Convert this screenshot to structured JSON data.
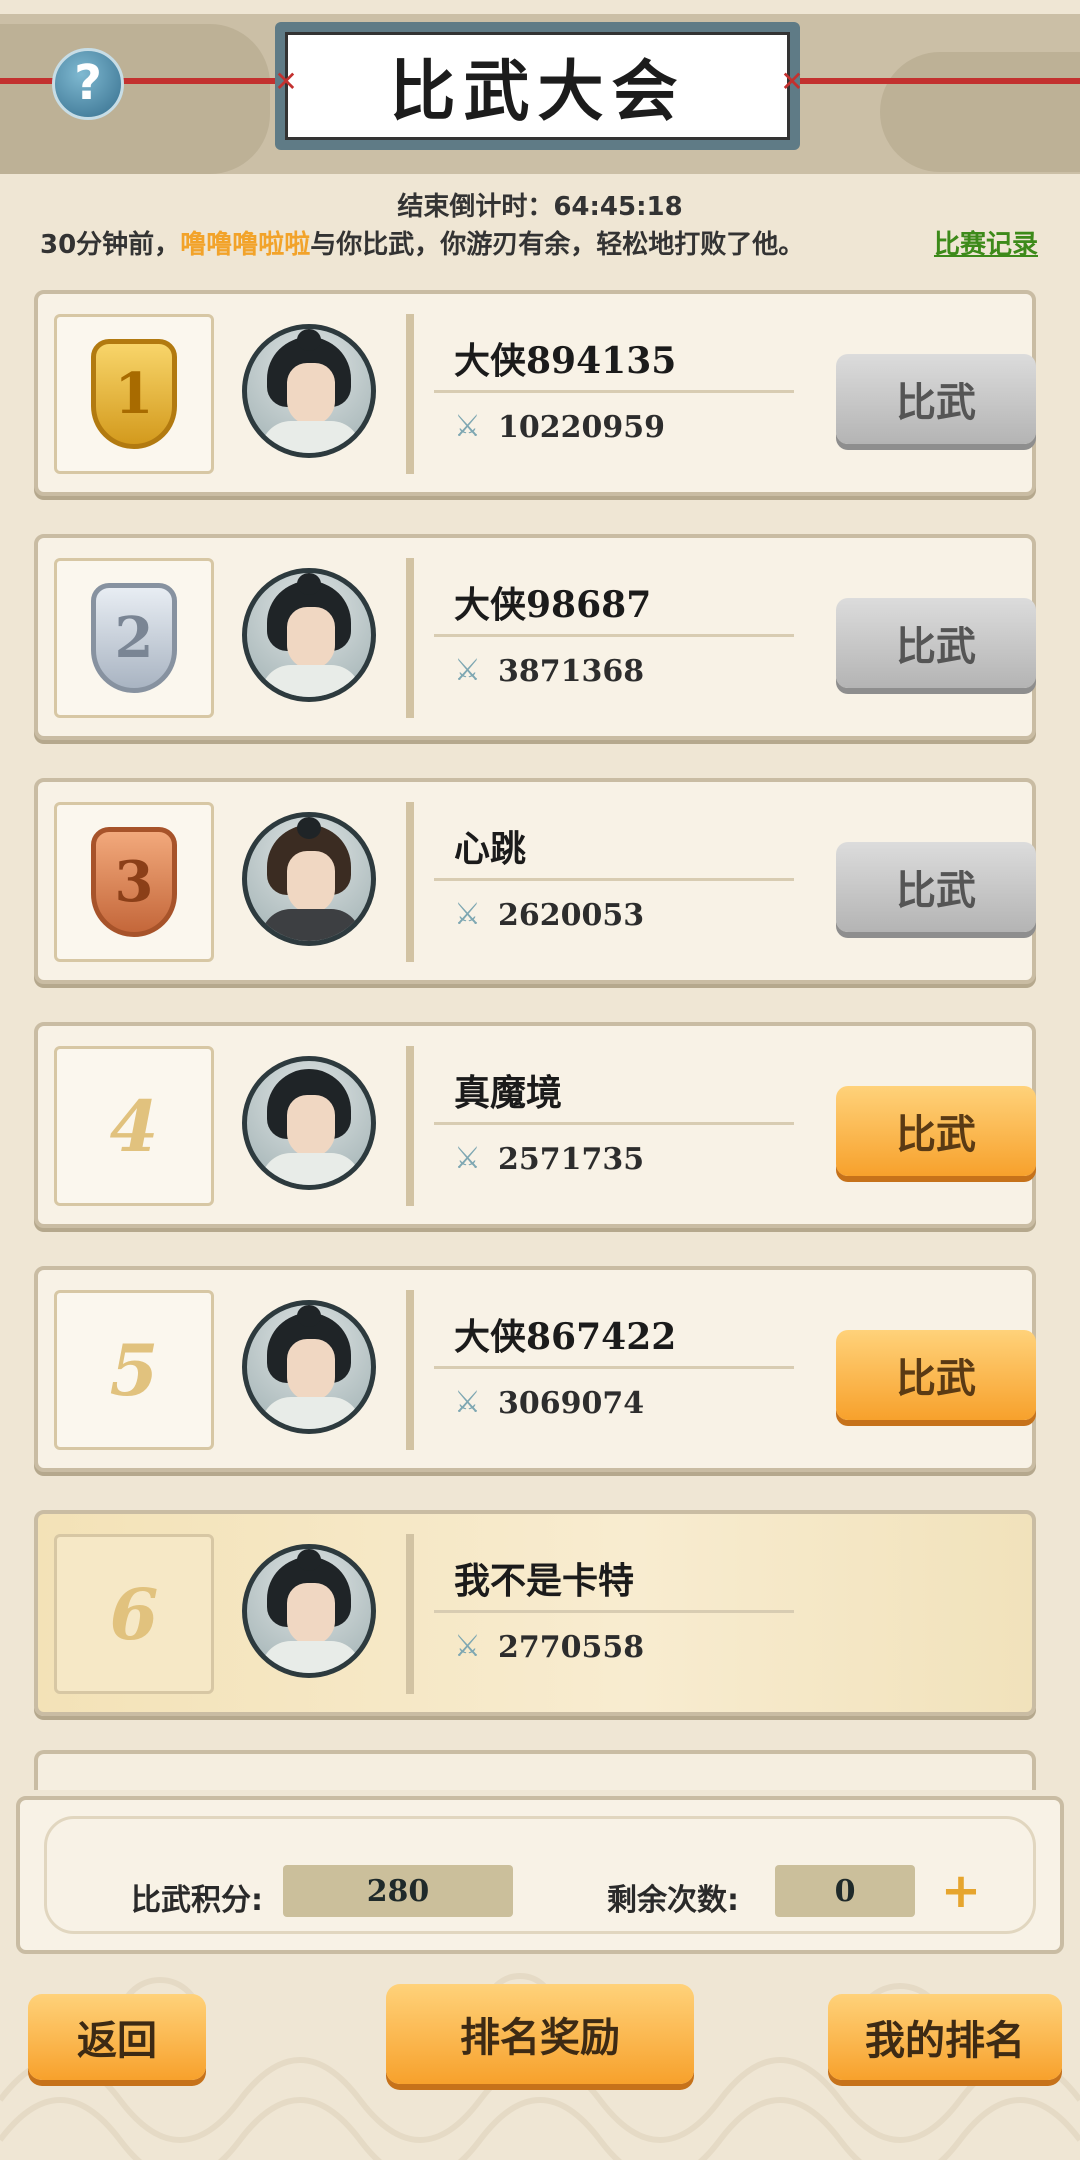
{
  "header": {
    "title": "比武大会",
    "help_label": "?"
  },
  "countdown": {
    "label": "结束倒计时：",
    "value": "64:45:18"
  },
  "notice": {
    "prefix": "30分钟前，",
    "opponent": "噜噜噜啦啦",
    "suffix": "与你比武，你游刃有余，轻松地打败了他。",
    "record_link": "比赛记录"
  },
  "rankings": [
    {
      "rank": "1",
      "name": "大侠894135",
      "power": "10220959",
      "button": "比武",
      "button_state": "gray"
    },
    {
      "rank": "2",
      "name": "大侠98687",
      "power": "3871368",
      "button": "比武",
      "button_state": "gray"
    },
    {
      "rank": "3",
      "name": "心跳",
      "power": "2620053",
      "button": "比武",
      "button_state": "gray"
    },
    {
      "rank": "4",
      "name": "真魔境",
      "power": "2571735",
      "button": "比武",
      "button_state": "orange"
    },
    {
      "rank": "5",
      "name": "大侠867422",
      "power": "3069074",
      "button": "比武",
      "button_state": "orange"
    },
    {
      "rank": "6",
      "name": "我不是卡特",
      "power": "2770558",
      "button": "",
      "button_state": "self"
    }
  ],
  "stats": {
    "points_label": "比武积分:",
    "points_value": "280",
    "remaining_label": "剩余次数:",
    "remaining_value": "0",
    "plus_label": "+"
  },
  "footer": {
    "back_label": "返回",
    "rewards_label": "排名奖励",
    "my_rank_label": "我的排名"
  },
  "colors": {
    "accent_orange": "#f7a12c",
    "highlight_name": "#f2a32a",
    "record_link": "#3d8a1a",
    "gray_button": "#b4b4b4"
  },
  "icons": {
    "help": "question-icon",
    "power": "crossed-swords-icon",
    "plus": "plus-icon",
    "medal_1": "gold-medal-icon",
    "medal_2": "silver-medal-icon",
    "medal_3": "bronze-medal-icon"
  }
}
